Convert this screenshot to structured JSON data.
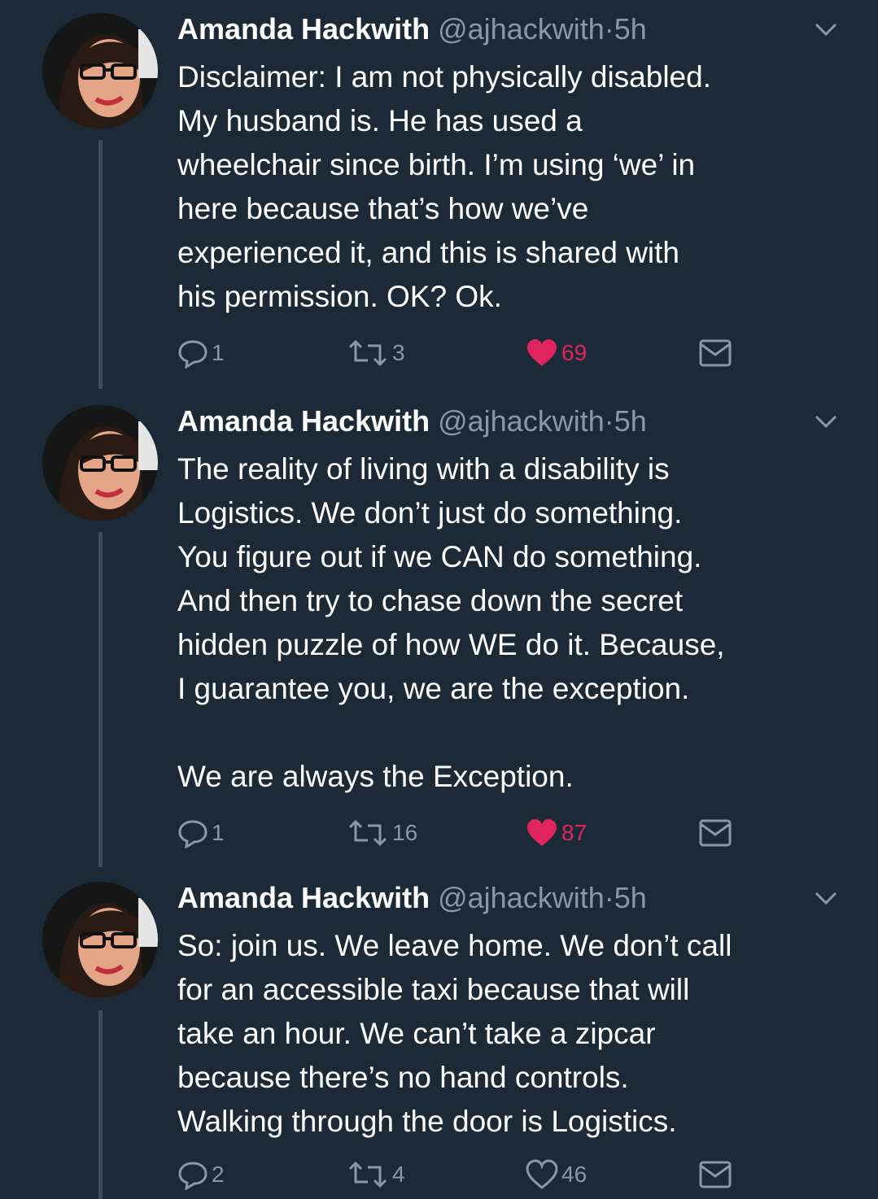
{
  "colors": {
    "background": "#1c2a38",
    "text": "#ffffff",
    "secondary": "#8899a6",
    "like_active": "#e0245e",
    "thread_line": "#3b4c5c"
  },
  "tweets": [
    {
      "name": "Amanda Hackwith",
      "handle": "@ajhackwith",
      "dot": "·",
      "time": "5h",
      "text": "Disclaimer: I am not physically disabled.\nMy husband is. He has used a\nwheelchair since birth. I’m using ‘we’ in\nhere because that’s how we’ve\nexperienced it, and this is shared with\nhis permission. OK? Ok.",
      "replies": "1",
      "retweets": "3",
      "likes": "69",
      "liked": true,
      "icons": [
        "reply-icon",
        "retweet-icon",
        "heart-icon",
        "direct-message-icon"
      ]
    },
    {
      "name": "Amanda Hackwith",
      "handle": "@ajhackwith",
      "dot": "·",
      "time": "5h",
      "text": "The reality of living with a disability is\nLogistics. We don’t just do something.\nYou figure out if we CAN do something.\nAnd then try to chase down the secret\nhidden puzzle of how WE do it. Because,\nI guarantee you, we are the exception.\n\nWe are always the Exception.",
      "replies": "1",
      "retweets": "16",
      "likes": "87",
      "liked": true,
      "icons": [
        "reply-icon",
        "retweet-icon",
        "heart-icon",
        "direct-message-icon"
      ]
    },
    {
      "name": "Amanda Hackwith",
      "handle": "@ajhackwith",
      "dot": "·",
      "time": "5h",
      "text": "So: join us. We leave home. We don’t call\nfor an accessible taxi because that will\ntake an hour. We can’t take a zipcar\nbecause there’s no hand controls.\nWalking through the door is Logistics.",
      "replies": "2",
      "retweets": "4",
      "likes": "46",
      "liked": false,
      "icons": [
        "reply-icon",
        "retweet-icon",
        "heart-icon",
        "direct-message-icon"
      ]
    }
  ]
}
